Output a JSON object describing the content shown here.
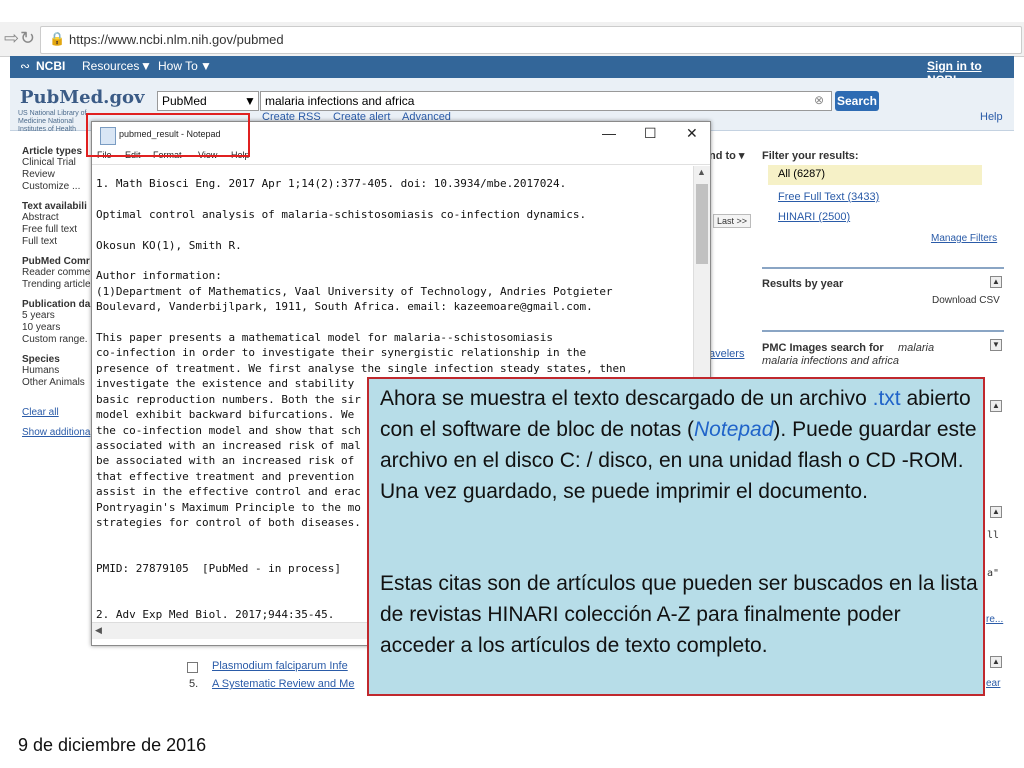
{
  "browser": {
    "url": "https://www.ncbi.nlm.nih.gov/pubmed"
  },
  "ncbi": {
    "logo": "NCBI",
    "resources": "Resources",
    "howto": "How To",
    "signin": "Sign in to NCBI"
  },
  "pubmed": {
    "logo": "PubMed.gov",
    "logo_sub": "US National Library of Medicine National Institutes of Health",
    "db_select": "PubMed",
    "search_value": "malaria infections and africa",
    "search_button": "Search",
    "create_rss": "Create RSS",
    "create_alert": "Create alert",
    "advanced": "Advanced",
    "help": "Help"
  },
  "left_filters": {
    "article_types": "Article types",
    "clinical_trial": "Clinical Trial",
    "review": "Review",
    "customize": "Customize ...",
    "text_availability": "Text availabili",
    "abstract": "Abstract",
    "free_full_text": "Free full text",
    "full_text": "Full text",
    "pubmed_commons": "PubMed Comr",
    "reader_comments": "Reader comme",
    "trending_articles": "Trending article",
    "publication_dates": "Publication da",
    "five_years": "5 years",
    "ten_years": "10 years",
    "custom_range": "Custom range.",
    "species": "Species",
    "humans": "Humans",
    "other_animals": "Other Animals",
    "clear_all": "Clear all",
    "show_additional": "Show additiona"
  },
  "right_panel": {
    "send_to": "nd to ▾",
    "last": "Last >>",
    "filter_title": "Filter your results:",
    "all": "All (6287)",
    "free_full_text": "Free Full Text (3433)",
    "hinari": "HINARI (2500)",
    "manage_filters": "Manage Filters",
    "results_by_year": "Results by year",
    "download_csv": "Download CSV",
    "pmc_images": "PMC Images search for",
    "pmc_query": "malaria infections and africa",
    "travelers": "avelers",
    "re": "re...",
    "ear": "ear",
    "ll": "ll",
    "a_quote": "a\""
  },
  "results": [
    {
      "num": "",
      "title": "Plasmodium falciparum Infe"
    },
    {
      "num": "5.",
      "title": "A Systematic Review and Me"
    }
  ],
  "notepad": {
    "title": "pubmed_result - Notepad",
    "menu": [
      "File",
      "Edit",
      "Format",
      "View",
      "Help"
    ],
    "content": "1. Math Biosci Eng. 2017 Apr 1;14(2):377-405. doi: 10.3934/mbe.2017024.\n\nOptimal control analysis of malaria-schistosomiasis co-infection dynamics.\n\nOkosun KO(1), Smith R.\n\nAuthor information:\n(1)Department of Mathematics, Vaal University of Technology, Andries Potgieter\nBoulevard, Vanderbijlpark, 1911, South Africa. email: kazeemoare@gmail.com.\n\nThis paper presents a mathematical model for malaria--schistosomiasis\nco-infection in order to investigate their synergistic relationship in the\npresence of treatment. We first analyse the single infection steady states, then\ninvestigate the existence and stability\nbasic reproduction numbers. Both the sir\nmodel exhibit backward bifurcations. We\nthe co-infection model and show that sch\nassociated with an increased risk of mal\nbe associated with an increased risk of\nthat effective treatment and prevention\nassist in the effective control and erac\nPontryagin's Maximum Principle to the mo\nstrategies for control of both diseases.\n\n\nPMID: 27879105  [PubMed - in process]\n\n\n2. Adv Exp Med Biol. 2017;944:35-45."
  },
  "callout": {
    "p1_a": "Ahora se muestra el texto descargado de un archivo ",
    "p1_txt": ".txt",
    "p1_b": " abierto con el software de bloc de notas (",
    "p1_notepad": "Notepad",
    "p1_c": "). Puede guardar este archivo en el disco C: / disco, en una unidad flash o CD -ROM. Una vez guardado, se puede imprimir el documento.",
    "p2": "Estas citas son de artículos que pueden ser buscados en la lista de revistas HINARI colección A-Z para finalmente poder acceder a los artículos de texto completo."
  },
  "footer": {
    "date": "9 de diciembre de 2016"
  },
  "colors": {
    "ncbi_blue": "#336699",
    "highlight_red": "#e02020",
    "callout_bg": "#b7dde8",
    "callout_border": "#c0282d"
  }
}
